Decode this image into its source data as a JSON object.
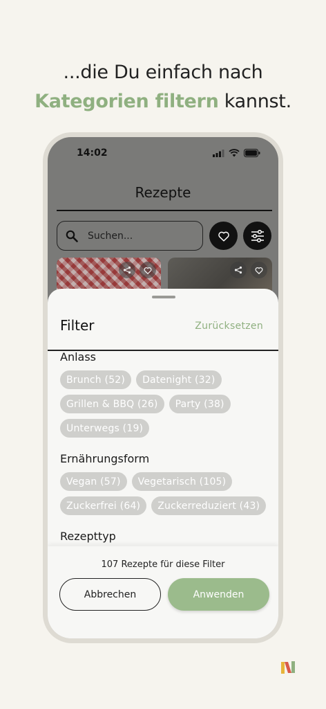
{
  "headline": {
    "line1": "...die Du einfach nach",
    "accent": "Kategorien filtern",
    "rest": " kannst."
  },
  "status_bar": {
    "time": "14:02"
  },
  "app": {
    "title": "Rezepte",
    "search": {
      "placeholder": "Suchen...",
      "value": ""
    }
  },
  "filter_sheet": {
    "title": "Filter",
    "reset_label": "Zurücksetzen",
    "sections": [
      {
        "label": "Anlass",
        "chips": [
          "Brunch (52)",
          "Datenight (32)",
          "Grillen & BBQ (26)",
          "Party (38)",
          "Unterwegs (19)"
        ]
      },
      {
        "label": "Ernährungsform",
        "chips": [
          "Vegan (57)",
          "Vegetarisch (105)",
          "Zuckerfrei (64)",
          "Zuckerreduziert (43)"
        ]
      },
      {
        "label": "Rezepttyp",
        "chips": []
      }
    ],
    "result_count": "107 Rezepte für diese Filter",
    "cancel_label": "Abbrechen",
    "apply_label": "Anwenden"
  },
  "colors": {
    "accent": "#8fb080",
    "chip_bg": "#cfcfcc",
    "apply_button": "#9bbb8c",
    "background": "#f6f4ee"
  },
  "icons": [
    "search-icon",
    "heart-icon",
    "filter-sliders-icon",
    "share-icon",
    "signal-icon",
    "wifi-icon",
    "battery-icon",
    "brand-logo"
  ]
}
